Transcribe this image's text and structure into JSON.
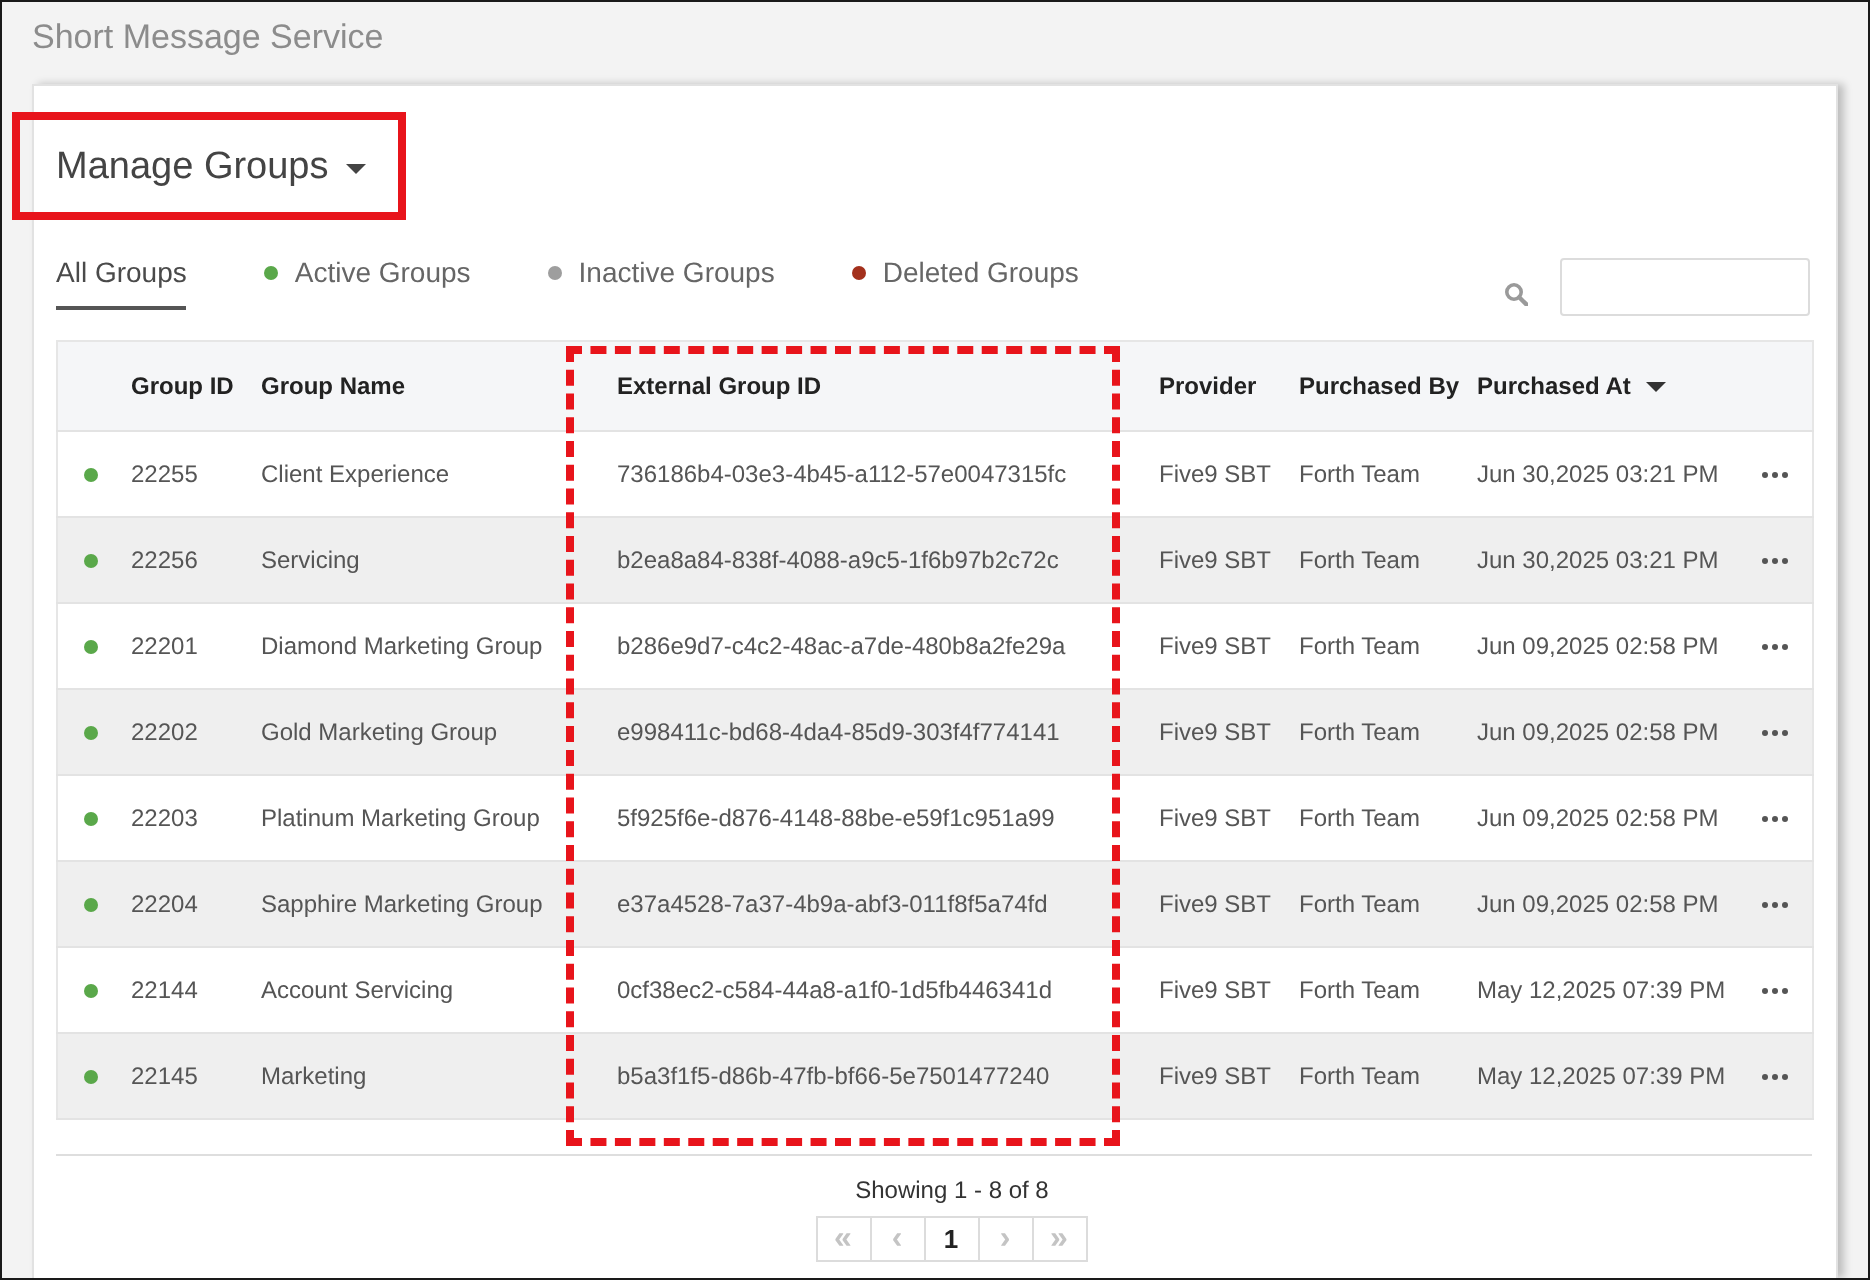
{
  "page_title": "Short Message Service",
  "heading": {
    "title": "Manage Groups",
    "highlighted": true
  },
  "tabs": [
    {
      "label": "All Groups",
      "selected": true
    },
    {
      "label": "Active Groups",
      "selected": false,
      "color": "#5aa84a"
    },
    {
      "label": "Inactive Groups",
      "selected": false,
      "color": "#9e9e9e"
    },
    {
      "label": "Deleted Groups",
      "selected": false,
      "color": "#a3301c"
    }
  ],
  "table": {
    "columns": [
      {
        "label": "Group ID",
        "sorted": false,
        "highlighted": false
      },
      {
        "label": "Group Name",
        "sorted": false,
        "highlighted": false
      },
      {
        "label": "External Group ID",
        "sorted": false,
        "highlighted": true
      },
      {
        "label": "Provider",
        "sorted": false,
        "highlighted": false
      },
      {
        "label": "Purchased By",
        "sorted": false,
        "highlighted": false
      },
      {
        "label": "Purchased At",
        "sorted": true,
        "highlighted": false
      }
    ],
    "rows": [
      {
        "color": "#5aa84a",
        "group_id": "22255",
        "group_name": "Client Experience",
        "external_group_id": "736186b4-03e3-4b45-a112-57e0047315fc",
        "provider": "Five9 SBT",
        "purchased_by": "Forth Team",
        "purchased_at": "Jun 30,2025 03:21 PM"
      },
      {
        "color": "#5aa84a",
        "group_id": "22256",
        "group_name": "Servicing",
        "external_group_id": "b2ea8a84-838f-4088-a9c5-1f6b97b2c72c",
        "provider": "Five9 SBT",
        "purchased_by": "Forth Team",
        "purchased_at": "Jun 30,2025 03:21 PM"
      },
      {
        "color": "#5aa84a",
        "group_id": "22201",
        "group_name": "Diamond Marketing Group",
        "external_group_id": "b286e9d7-c4c2-48ac-a7de-480b8a2fe29a",
        "provider": "Five9 SBT",
        "purchased_by": "Forth Team",
        "purchased_at": "Jun 09,2025 02:58 PM"
      },
      {
        "color": "#5aa84a",
        "group_id": "22202",
        "group_name": "Gold Marketing Group",
        "external_group_id": "e998411c-bd68-4da4-85d9-303f4f774141",
        "provider": "Five9 SBT",
        "purchased_by": "Forth Team",
        "purchased_at": "Jun 09,2025 02:58 PM"
      },
      {
        "color": "#5aa84a",
        "group_id": "22203",
        "group_name": "Platinum Marketing Group",
        "external_group_id": "5f925f6e-d876-4148-88be-e59f1c951a99",
        "provider": "Five9 SBT",
        "purchased_by": "Forth Team",
        "purchased_at": "Jun 09,2025 02:58 PM"
      },
      {
        "color": "#5aa84a",
        "group_id": "22204",
        "group_name": "Sapphire Marketing Group",
        "external_group_id": "e37a4528-7a37-4b9a-abf3-011f8f5a74fd",
        "provider": "Five9 SBT",
        "purchased_by": "Forth Team",
        "purchased_at": "Jun 09,2025 02:58 PM"
      },
      {
        "color": "#5aa84a",
        "group_id": "22144",
        "group_name": "Account Servicing",
        "external_group_id": "0cf38ec2-c584-44a8-a1f0-1d5fb446341d",
        "provider": "Five9 SBT",
        "purchased_by": "Forth Team",
        "purchased_at": "May 12,2025 07:39 PM"
      },
      {
        "color": "#5aa84a",
        "group_id": "22145",
        "group_name": "Marketing",
        "external_group_id": "b5a3f1f5-d86b-47fb-bf66-5e7501477240",
        "provider": "Five9 SBT",
        "purchased_by": "Forth Team",
        "purchased_at": "May 12,2025 07:39 PM"
      }
    ]
  },
  "pagination": {
    "summary": "Showing 1 - 8 of 8",
    "buttons": [
      {
        "kind": "nav",
        "label": "«",
        "disabled": true
      },
      {
        "kind": "nav",
        "label": "‹",
        "disabled": true
      },
      {
        "kind": "page",
        "label": "1",
        "selected": true
      },
      {
        "kind": "nav",
        "label": "›",
        "disabled": true
      },
      {
        "kind": "nav",
        "label": "»",
        "disabled": true
      }
    ]
  }
}
